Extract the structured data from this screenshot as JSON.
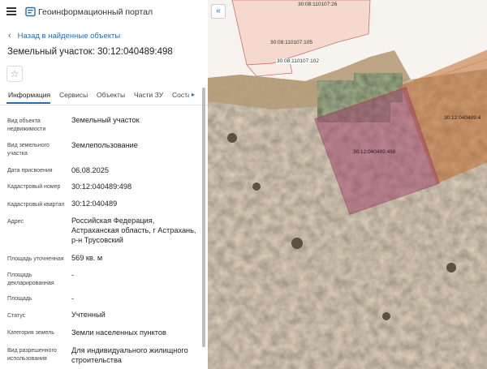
{
  "header": {
    "portal_title": "Геоинформационный портал"
  },
  "nav": {
    "back_label": "Назад в найденные объекты"
  },
  "object": {
    "title": "Земельный участок: 30:12:040489:498"
  },
  "tabs": [
    {
      "label": "Информация"
    },
    {
      "label": "Сервисы"
    },
    {
      "label": "Объекты"
    },
    {
      "label": "Части ЗУ"
    },
    {
      "label": "Соста"
    }
  ],
  "fields": [
    {
      "label": "Вид объекта недвижимости",
      "value": "Земельный участок"
    },
    {
      "label": "Вид земельного участка",
      "value": "Землепользование"
    },
    {
      "label": "Дата присвоения",
      "value": "06.08.2025"
    },
    {
      "label": "Кадастровый номер",
      "value": "30:12:040489:498"
    },
    {
      "label": "Кадастровый квартал",
      "value": "30:12:040489"
    },
    {
      "label": "Адрес",
      "value": "Российская Федерация, Астраханская область, г Астрахань, р-н Трусовский"
    },
    {
      "label": "Площадь уточненная",
      "value": "569 кв. м"
    },
    {
      "label": "Площадь декларированная",
      "value": "-"
    },
    {
      "label": "Площадь",
      "value": "-"
    },
    {
      "label": "Статус",
      "value": "Учтенный"
    },
    {
      "label": "Категория земель",
      "value": "Земли населенных пунктов"
    },
    {
      "label": "Вид разрешенного использования",
      "value": "Для индивидуального жилищного строительства"
    }
  ],
  "map": {
    "parcel_labels": {
      "top": "30:08:110107:26",
      "mid1": "30:08:110107:105",
      "mid2": "30:08:110107:102",
      "selected": "30:12:040489:498",
      "right": "30:12:040489:4"
    }
  },
  "colors": {
    "accent": "#2b6cb0",
    "selected_parcel": "#b0486e",
    "neighbor_parcel": "#c4702a",
    "top_parcel": "#f3ddd0"
  }
}
